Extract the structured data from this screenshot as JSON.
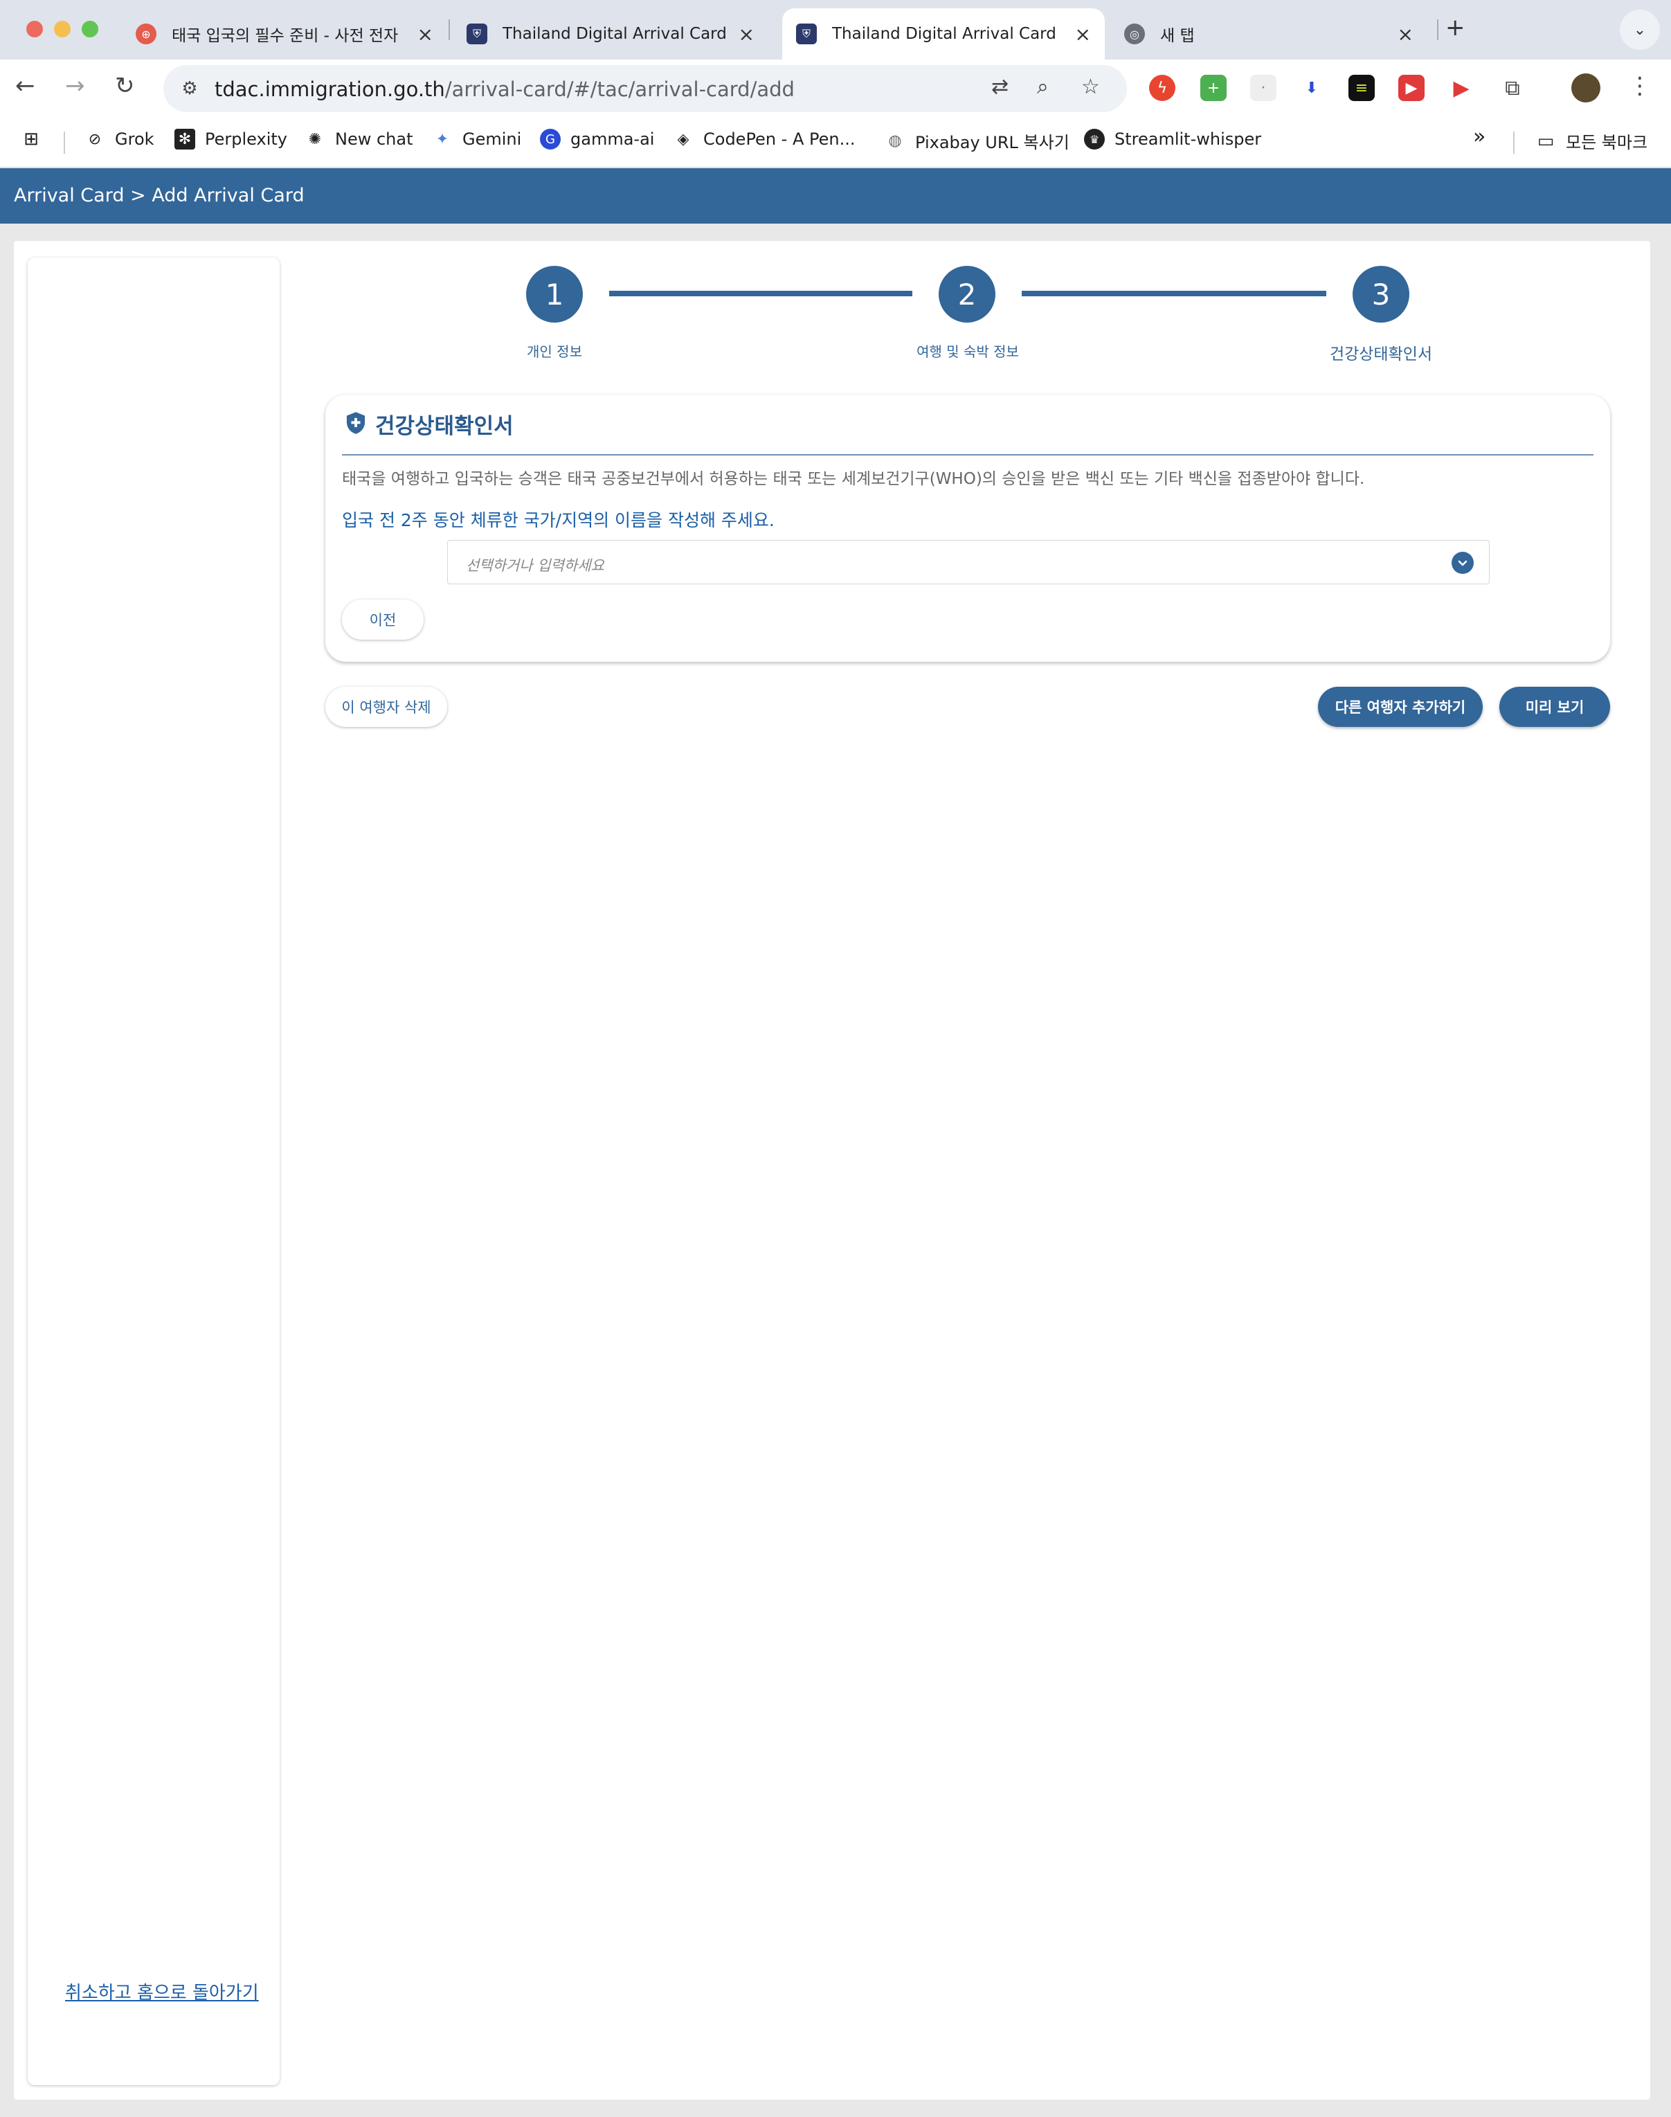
{
  "browser": {
    "tabs": [
      {
        "title": "태국 입국의 필수 준비 - 사전 전자"
      },
      {
        "title": "Thailand Digital Arrival Card"
      },
      {
        "title": "Thailand Digital Arrival Card"
      },
      {
        "title": "새 탭"
      }
    ],
    "url_host": "tdac.immigration.go.th",
    "url_path": "/arrival-card/#/tac/arrival-card/add",
    "bookmarks": [
      "Grok",
      "Perplexity",
      "New chat",
      "Gemini",
      "gamma-ai",
      "CodePen - A Pen...",
      "Pixabay URL 복사기",
      "Streamlit-whisper"
    ],
    "all_bookmarks": "모든 북마크",
    "overflow": "»"
  },
  "header": {
    "breadcrumb": "Arrival Card > Add Arrival Card"
  },
  "stepper": {
    "steps": [
      {
        "number": "1",
        "label": "개인 정보"
      },
      {
        "number": "2",
        "label": "여행 및 숙박 정보"
      },
      {
        "number": "3",
        "label": "건강상태확인서"
      }
    ]
  },
  "health": {
    "title": "건강상태확인서",
    "description": "태국을 여행하고 입국하는 승객은 태국 공중보건부에서 허용하는 태국 또는 세계보건기구(WHO)의 승인을 받은 백신 또는 기타 백신을 접종받아야 합니다.",
    "prompt": "입국 전 2주 동안 체류한 국가/지역의 이름을 작성해 주세요.",
    "select_placeholder": "선택하거나 입력하세요",
    "prev_button": "이전"
  },
  "actions": {
    "delete_traveler": "이 여행자 삭제",
    "add_traveler": "다른 여행자 추가하기",
    "preview": "미리 보기"
  },
  "sidebar": {
    "cancel_link": "취소하고 홈으로 돌아가기"
  },
  "colors": {
    "primary": "#336699",
    "link": "#1a5fa8"
  }
}
